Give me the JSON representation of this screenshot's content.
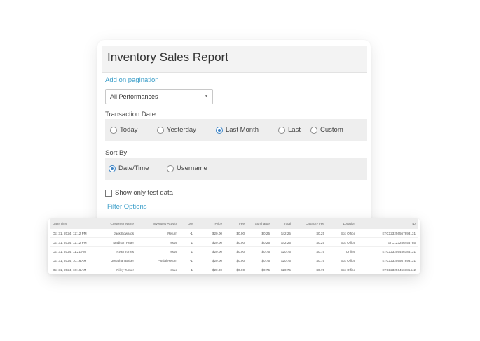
{
  "report": {
    "title": "Inventory Sales Report",
    "pagination_link": "Add on pagination",
    "performance_select": {
      "value": "All Performances",
      "chevron_icon": "chevron-down-icon"
    },
    "transaction_date": {
      "label": "Transaction Date",
      "options": [
        "Today",
        "Yesterday",
        "Last Month",
        "Last",
        "Custom"
      ],
      "selected": "Last Month"
    },
    "sort_by": {
      "label": "Sort By",
      "options": [
        "Date/Time",
        "Username"
      ],
      "selected": "Date/Time"
    },
    "test_data_checkbox": {
      "label": "Show only test data",
      "checked": false
    },
    "filter_link": "Filter Options"
  },
  "table": {
    "columns": [
      "Date/Time",
      "Customer Name",
      "Inventory Activity",
      "Qty",
      "Price",
      "Fee",
      "Surcharge",
      "Total",
      "Capacity Fee",
      "Location",
      "ID"
    ],
    "rows": [
      [
        "Oct 31, 2024, 12:12 PM",
        "Jack Edwards",
        "Return",
        "-1",
        "$20.00",
        "$0.00",
        "$0.25",
        "$42.25",
        "$0.25",
        "Box Office",
        "ETC123256567893131"
      ],
      [
        "Oct 31, 2024, 12:12 PM",
        "Madison Peter",
        "Issue",
        "1",
        "$20.00",
        "$0.00",
        "$0.25",
        "$42.25",
        "$0.25",
        "Box Office",
        "ETC123256456785"
      ],
      [
        "Oct 31, 2024, 11:21 AM",
        "Ryan Torres",
        "Issue",
        "1",
        "$20.00",
        "$0.00",
        "$0.75",
        "$20.75",
        "$0.75",
        "Online",
        "ETC123256456785131"
      ],
      [
        "Oct 31, 2024, 10:16 AM",
        "Jonathan Baker",
        "Partial Return",
        "-1",
        "$20.00",
        "$0.00",
        "$0.75",
        "$20.75",
        "$0.75",
        "Box Office",
        "ETC123256567893131"
      ],
      [
        "Oct 31, 2024, 10:16 AM",
        "Riley Turner",
        "Issue",
        "1",
        "$20.00",
        "$0.00",
        "$0.75",
        "$20.75",
        "$0.75",
        "Box Office",
        "ETC123256456785442"
      ]
    ]
  }
}
